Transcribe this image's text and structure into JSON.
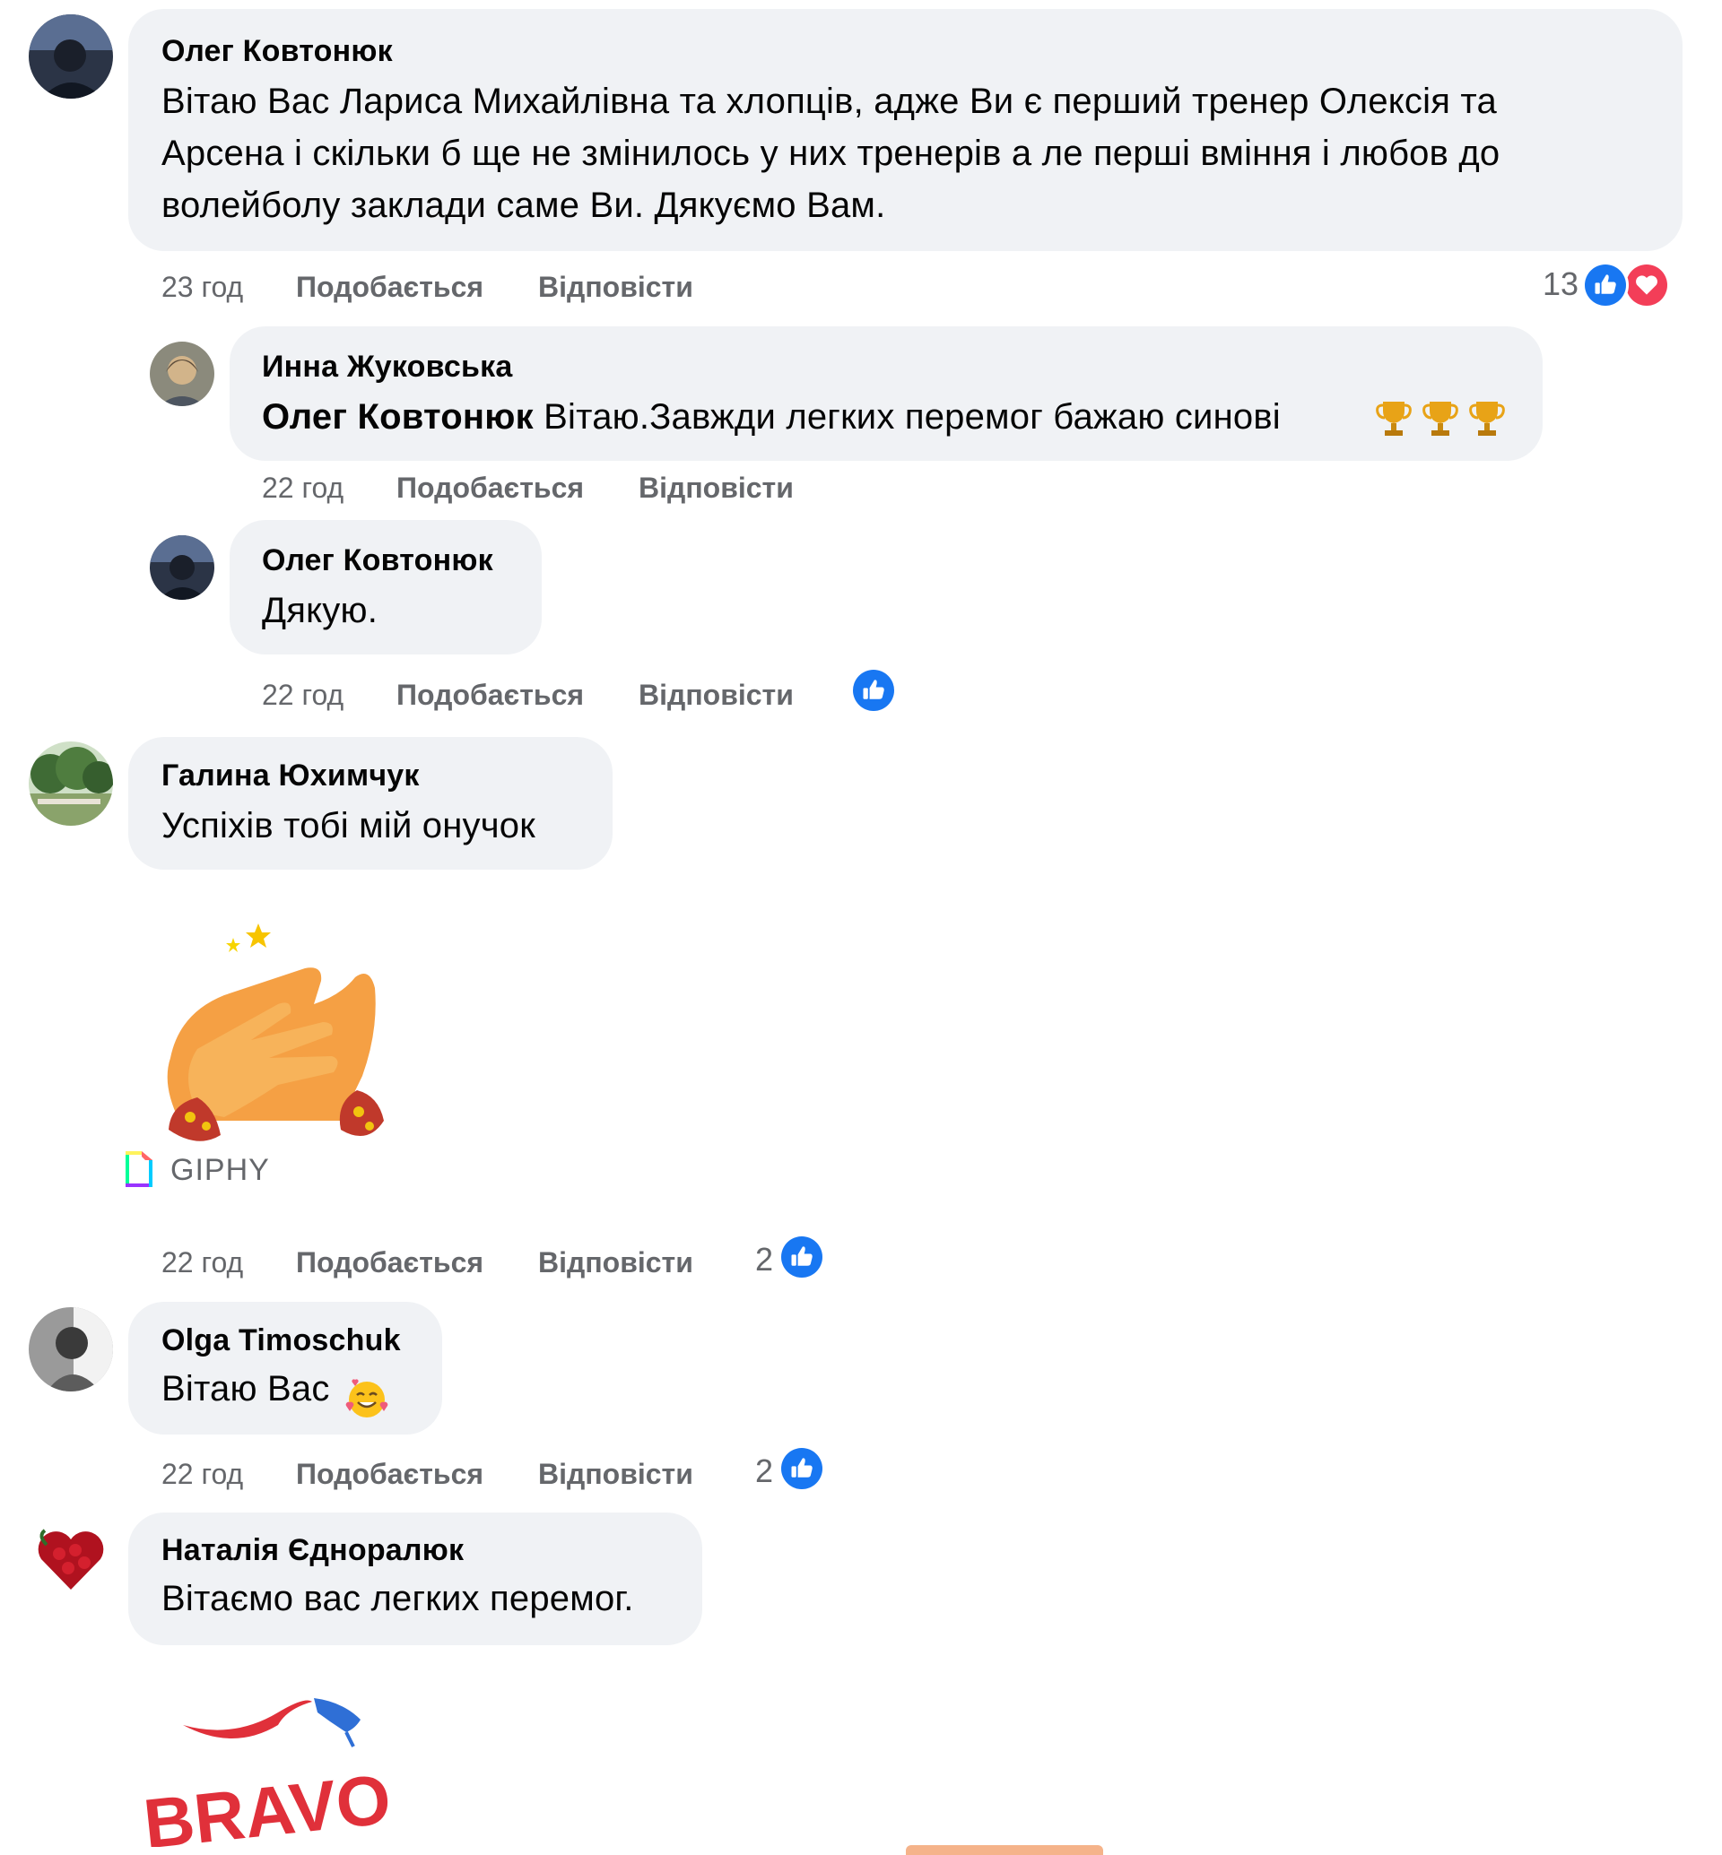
{
  "comments": [
    {
      "author": "Олег Ковтонюк",
      "text_lines": [
        "Вітаю Вас Лариса Михайлівна та хлопців, адже Ви є перший тренер Олексія та",
        "Арсена і скільки б ще не змінилось у них тренерів а ле перші вміння і любов до",
        "волейболу заклади саме Ви. Дякуємо Вам."
      ],
      "time": "23 год",
      "like": "Подобається",
      "reply": "Відповісти",
      "reaction_count": "13",
      "reactions": [
        "like-icon",
        "love-icon"
      ]
    },
    {
      "author": "Инна Жуковська",
      "mention": "Олег Ковтонюк",
      "text": " Вітаю.Завжди легких перемог бажаю синові",
      "emoji": [
        "trophy-icon",
        "trophy-icon",
        "trophy-icon"
      ],
      "time": "22 год",
      "like": "Подобається",
      "reply": "Відповісти"
    },
    {
      "author": "Олег Ковтонюк",
      "text": "Дякую.",
      "time": "22 год",
      "like": "Подобається",
      "reply": "Відповісти",
      "reactions": [
        "like-icon"
      ]
    },
    {
      "author": "Галина Юхимчук",
      "text": "Успіхів тобі мій онучок",
      "sticker": "clapping-hands-sticker",
      "sticker_source": "GIPHY",
      "time": "22 год",
      "like": "Подобається",
      "reply": "Відповісти",
      "reaction_count": "2",
      "reactions": [
        "like-icon"
      ]
    },
    {
      "author": "Olga Timoschuk",
      "text": "Вітаю Вас",
      "emoji": [
        "smiling-face-with-hearts-icon"
      ],
      "time": "22 год",
      "like": "Подобається",
      "reply": "Відповісти",
      "reaction_count": "2",
      "reactions": [
        "like-icon"
      ]
    },
    {
      "author": "Наталія Єдноралюк",
      "text": "Вітаємо вас легких перемог.",
      "sticker": "bravo-sticker",
      "sticker_text": "BRAVO"
    }
  ],
  "colors": {
    "bubble": "#f0f2f5",
    "meta_text": "#65676b",
    "like_blue": "#1877f2",
    "love_red": "#f33e58"
  }
}
